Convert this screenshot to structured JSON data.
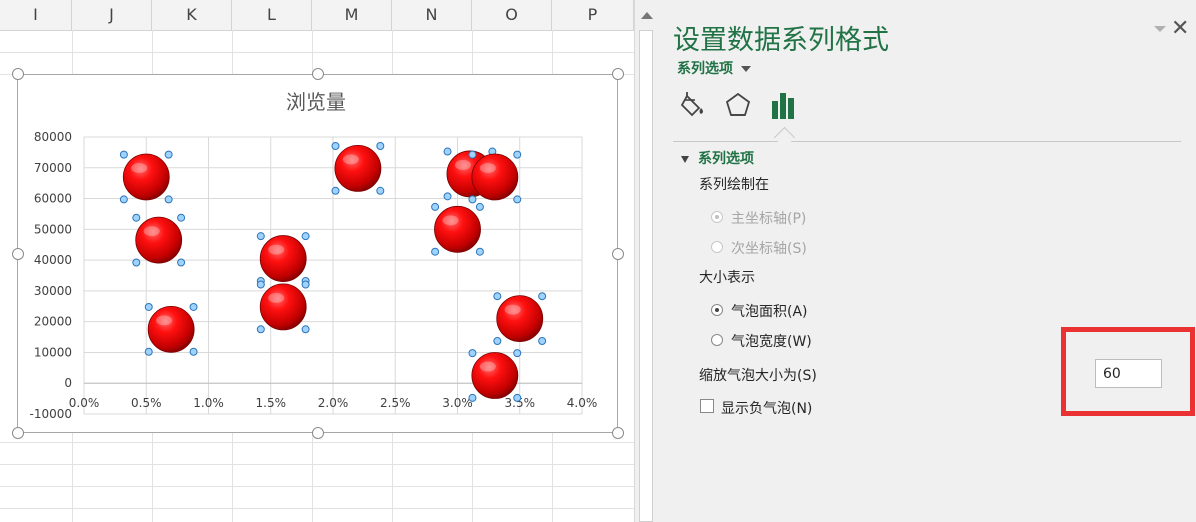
{
  "spreadsheet": {
    "columns": [
      "I",
      "J",
      "K",
      "L",
      "M",
      "N",
      "O",
      "P"
    ]
  },
  "chart_data": {
    "type": "bubble",
    "title": "浏览量",
    "x_ticks": [
      "0.0%",
      "0.5%",
      "1.0%",
      "1.5%",
      "2.0%",
      "2.5%",
      "3.0%",
      "3.5%",
      "4.0%"
    ],
    "y_ticks": [
      "80000",
      "70000",
      "60000",
      "50000",
      "40000",
      "30000",
      "20000",
      "10000",
      "0",
      "-10000"
    ],
    "xlim": [
      0.0,
      4.0
    ],
    "ylim": [
      -10000,
      80000
    ],
    "x_unit": "%",
    "grid": true,
    "legend": "none",
    "bubble_color": "#e30000",
    "selected": true,
    "points": [
      {
        "x": 0.5,
        "y": 67000
      },
      {
        "x": 0.6,
        "y": 46500
      },
      {
        "x": 0.7,
        "y": 17500
      },
      {
        "x": 1.6,
        "y": 40500
      },
      {
        "x": 1.6,
        "y": 24800
      },
      {
        "x": 2.2,
        "y": 69800
      },
      {
        "x": 3.0,
        "y": 50000
      },
      {
        "x": 3.1,
        "y": 68000
      },
      {
        "x": 3.3,
        "y": 67000
      },
      {
        "x": 3.5,
        "y": 21000
      },
      {
        "x": 3.3,
        "y": 2500
      }
    ]
  },
  "pane": {
    "title": "设置数据系列格式",
    "close_symbol": "✕",
    "dropdown_label": "系列选项",
    "tabs": [
      {
        "name": "fill-line",
        "icon": "paint-bucket-icon"
      },
      {
        "name": "effects",
        "icon": "pentagon-icon"
      },
      {
        "name": "series-options",
        "icon": "bar-chart-icon",
        "active": true
      }
    ],
    "section_title": "系列选项",
    "plot_on_label": "系列绘制在",
    "primary_axis": "主坐标轴(P)",
    "secondary_axis": "次坐标轴(S)",
    "size_represents_label": "大小表示",
    "bubble_area": "气泡面积(A)",
    "bubble_width": "气泡宽度(W)",
    "scale_label": "缩放气泡大小为(S)",
    "scale_value": "60",
    "show_negative": "显示负气泡(N)",
    "accent_color": "#217346",
    "highlight_color": "#ea3232"
  }
}
